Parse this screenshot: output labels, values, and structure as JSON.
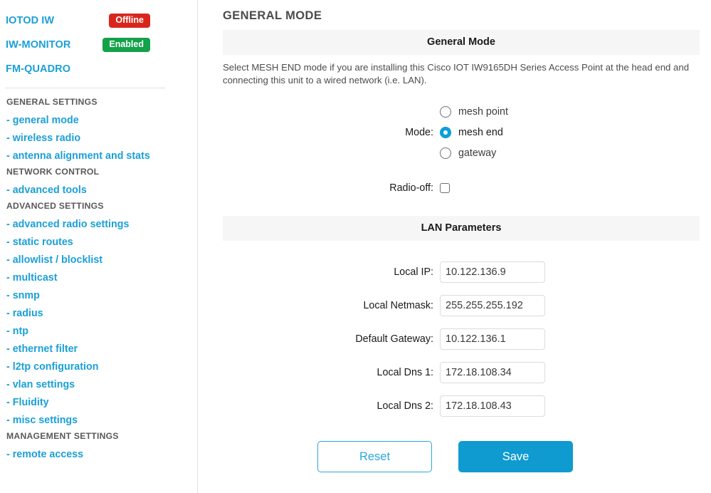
{
  "sidebar": {
    "top_links": [
      {
        "label": "IOTOD IW",
        "badge": "Offline",
        "badge_color": "#d9261c"
      },
      {
        "label": "IW-MONITOR",
        "badge": "Enabled",
        "badge_color": "#13a14a"
      },
      {
        "label": "FM-QUADRO",
        "badge": null,
        "badge_color": null
      }
    ],
    "groups": [
      {
        "title": "GENERAL SETTINGS",
        "items": [
          "- general mode",
          "- wireless radio",
          "- antenna alignment and stats"
        ]
      },
      {
        "title": "NETWORK CONTROL",
        "items": [
          "- advanced tools"
        ]
      },
      {
        "title": "ADVANCED SETTINGS",
        "items": [
          "- advanced radio settings",
          "- static routes",
          "- allowlist / blocklist",
          "- multicast",
          "- snmp",
          "- radius",
          "- ntp",
          "- ethernet filter",
          "- l2tp configuration",
          "- vlan settings",
          "- Fluidity",
          "- misc settings"
        ]
      },
      {
        "title": "MANAGEMENT SETTINGS",
        "items": [
          "- remote access"
        ]
      }
    ]
  },
  "main": {
    "page_title": "GENERAL MODE",
    "general_mode": {
      "section_title": "General Mode",
      "description": "Select MESH END mode if you are installing this Cisco IOT IW9165DH Series Access Point at the head end and connecting this unit to a wired network (i.e. LAN).",
      "mode_label": "Mode:",
      "options": [
        {
          "label": "mesh point",
          "selected": false
        },
        {
          "label": "mesh end",
          "selected": true
        },
        {
          "label": "gateway",
          "selected": false
        }
      ],
      "radio_off_label": "Radio-off:",
      "radio_off_checked": false
    },
    "lan_parameters": {
      "section_title": "LAN Parameters",
      "fields": [
        {
          "label": "Local IP:",
          "value": "10.122.136.9"
        },
        {
          "label": "Local Netmask:",
          "value": "255.255.255.192"
        },
        {
          "label": "Default Gateway:",
          "value": "10.122.136.1"
        },
        {
          "label": "Local Dns 1:",
          "value": "172.18.108.34"
        },
        {
          "label": "Local Dns 2:",
          "value": "172.18.108.43"
        }
      ]
    },
    "buttons": {
      "reset_label": "Reset",
      "save_label": "Save",
      "accent_color": "#0f9bd0"
    }
  }
}
